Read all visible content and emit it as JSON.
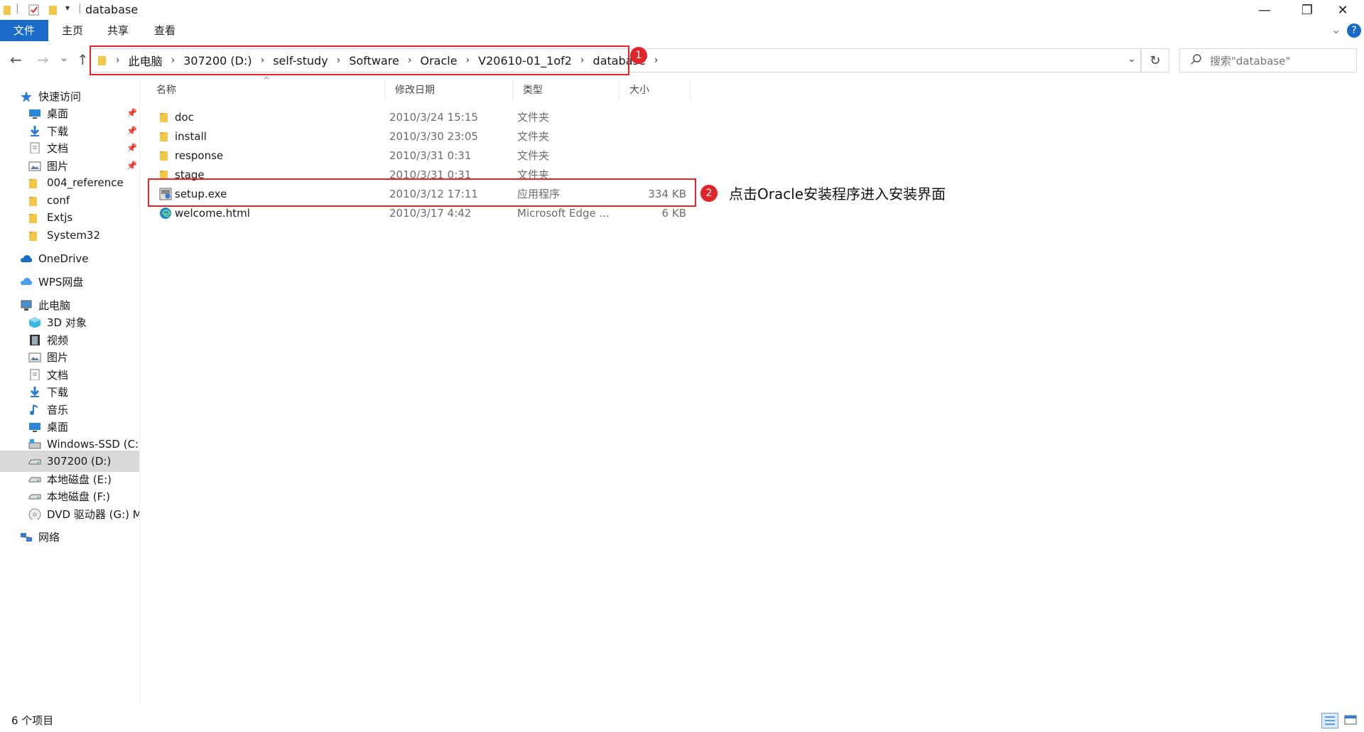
{
  "window": {
    "title": "database",
    "minimize": "—",
    "maximize": "❐",
    "close": "✕"
  },
  "ribbon": {
    "tabs": [
      "文件",
      "主页",
      "共享",
      "查看"
    ],
    "expand": "⌄",
    "help": "?"
  },
  "nav": {
    "back": "←",
    "forward": "→",
    "recent": "⌄",
    "up": "↑",
    "breadcrumbs": [
      "此电脑",
      "307200 (D:)",
      "self-study",
      "Software",
      "Oracle",
      "V20610-01_1of2",
      "database"
    ],
    "separator": "›",
    "dropdown": "⌄",
    "refresh": "↻",
    "search_placeholder": "搜索\"database\""
  },
  "sidebar": {
    "items": [
      {
        "label": "快速访问",
        "icon": "star-icon",
        "pinned": false
      },
      {
        "label": "桌面",
        "icon": "desktop-icon",
        "pinned": true
      },
      {
        "label": "下载",
        "icon": "download-icon",
        "pinned": true
      },
      {
        "label": "文档",
        "icon": "document-icon",
        "pinned": true
      },
      {
        "label": "图片",
        "icon": "picture-icon",
        "pinned": true
      },
      {
        "label": "004_reference",
        "icon": "folder-icon",
        "pinned": false
      },
      {
        "label": "conf",
        "icon": "folder-icon",
        "pinned": false
      },
      {
        "label": "Extjs",
        "icon": "folder-icon",
        "pinned": false
      },
      {
        "label": "System32",
        "icon": "folder-icon",
        "pinned": false
      },
      {
        "label": "OneDrive",
        "icon": "cloud-icon",
        "pinned": false
      },
      {
        "label": "WPS网盘",
        "icon": "wps-cloud-icon",
        "pinned": false
      },
      {
        "label": "此电脑",
        "icon": "computer-icon",
        "pinned": false
      },
      {
        "label": "3D 对象",
        "icon": "3d-objects-icon",
        "pinned": false
      },
      {
        "label": "视频",
        "icon": "video-icon",
        "pinned": false
      },
      {
        "label": "图片",
        "icon": "picture-icon",
        "pinned": false
      },
      {
        "label": "文档",
        "icon": "document-icon",
        "pinned": false
      },
      {
        "label": "下载",
        "icon": "download-icon",
        "pinned": false
      },
      {
        "label": "音乐",
        "icon": "music-icon",
        "pinned": false
      },
      {
        "label": "桌面",
        "icon": "desktop-icon",
        "pinned": false
      },
      {
        "label": "Windows-SSD (C:)",
        "icon": "system-drive-icon",
        "pinned": false
      },
      {
        "label": "307200 (D:)",
        "icon": "drive-icon",
        "pinned": false,
        "selected": true
      },
      {
        "label": "本地磁盘 (E:)",
        "icon": "drive-icon",
        "pinned": false
      },
      {
        "label": "本地磁盘 (F:)",
        "icon": "drive-icon",
        "pinned": false
      },
      {
        "label": "DVD 驱动器 (G:) M",
        "icon": "dvd-icon",
        "pinned": false
      },
      {
        "label": "网络",
        "icon": "network-icon",
        "pinned": false
      }
    ],
    "pin_glyph": "📌"
  },
  "columns": [
    "名称",
    "修改日期",
    "类型",
    "大小"
  ],
  "files": [
    {
      "name": "doc",
      "date": "2010/3/24 15:15",
      "type": "文件夹",
      "size": "",
      "icon": "folder-icon"
    },
    {
      "name": "install",
      "date": "2010/3/30 23:05",
      "type": "文件夹",
      "size": "",
      "icon": "folder-icon"
    },
    {
      "name": "response",
      "date": "2010/3/31 0:31",
      "type": "文件夹",
      "size": "",
      "icon": "folder-icon"
    },
    {
      "name": "stage",
      "date": "2010/3/31 0:31",
      "type": "文件夹",
      "size": "",
      "icon": "folder-icon"
    },
    {
      "name": "setup.exe",
      "date": "2010/3/12 17:11",
      "type": "应用程序",
      "size": "334 KB",
      "icon": "setup-exe-icon"
    },
    {
      "name": "welcome.html",
      "date": "2010/3/17 4:42",
      "type": "Microsoft Edge ...",
      "size": "6 KB",
      "icon": "edge-icon"
    }
  ],
  "annotations": {
    "badge1": "1",
    "badge2": "2",
    "note": "点击Oracle安装程序进入安装界面"
  },
  "status": {
    "item_count": "6 个项目"
  },
  "colors": {
    "accent": "#1a6bc7",
    "annotation": "#e0262b",
    "folder": "#f2c84b"
  }
}
